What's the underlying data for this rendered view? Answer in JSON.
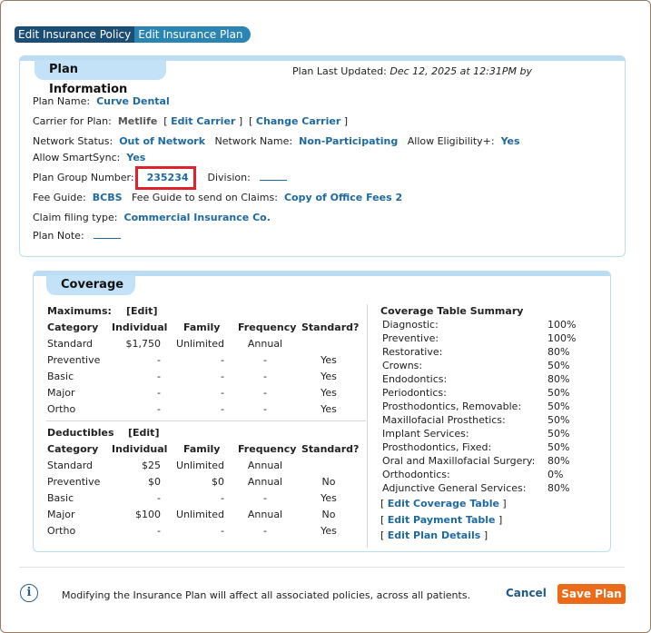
{
  "tabs": [
    "Edit Insurance Policy",
    "Edit Insurance Plan"
  ],
  "plan_info": {
    "header": "Plan Information",
    "last_updated_label": "Plan Last Updated:",
    "last_updated_value": "Dec 12, 2025 at 12:31PM by",
    "plan_name_label": "Plan Name:",
    "plan_name": "Curve Dental",
    "carrier_label": "Carrier for Plan:",
    "carrier": "Metlife",
    "edit_carrier": "Edit Carrier",
    "change_carrier": "Change Carrier",
    "network_status_label": "Network Status:",
    "network_status": "Out of Network",
    "network_name_label": "Network Name:",
    "network_name": "Non-Participating",
    "allow_eligibility_label": "Allow Eligibility+:",
    "allow_eligibility": "Yes",
    "allow_smartsync_label": "Allow SmartSync:",
    "allow_smartsync": "Yes",
    "group_number_label": "Plan Group Number:",
    "group_number": "235234",
    "division_label": "Division:",
    "fee_guide_label": "Fee Guide:",
    "fee_guide": "BCBS",
    "fee_guide_claims_label": "Fee Guide to send on Claims:",
    "fee_guide_claims": "Copy of Office Fees 2",
    "claim_type_label": "Claim filing type:",
    "claim_type": "Commercial Insurance Co.",
    "plan_note_label": "Plan Note:"
  },
  "coverage": {
    "header": "Coverage",
    "maximums_label": "Maximums:",
    "deductibles_label": "Deductibles",
    "edit_label": "[Edit]",
    "columns": [
      "Category",
      "Individual",
      "Family",
      "Frequency",
      "Standard?"
    ],
    "maximums": [
      [
        "Standard",
        "$1,750",
        "Unlimited",
        "Annual",
        ""
      ],
      [
        "Preventive",
        "-",
        "-",
        "-",
        "Yes"
      ],
      [
        "Basic",
        "-",
        "-",
        "-",
        "Yes"
      ],
      [
        "Major",
        "-",
        "-",
        "-",
        "Yes"
      ],
      [
        "Ortho",
        "-",
        "-",
        "-",
        "Yes"
      ]
    ],
    "deductibles": [
      [
        "Standard",
        "$25",
        "Unlimited",
        "Annual",
        ""
      ],
      [
        "Preventive",
        "$0",
        "$0",
        "Annual",
        "No"
      ],
      [
        "Basic",
        "-",
        "-",
        "-",
        "Yes"
      ],
      [
        "Major",
        "$100",
        "Unlimited",
        "Annual",
        "No"
      ],
      [
        "Ortho",
        "-",
        "-",
        "-",
        "Yes"
      ]
    ],
    "summary_title": "Coverage Table Summary",
    "summary": [
      [
        "Diagnostic:",
        "100%"
      ],
      [
        "Preventive:",
        "100%"
      ],
      [
        "Restorative:",
        "80%"
      ],
      [
        "Crowns:",
        "50%"
      ],
      [
        "Endodontics:",
        "80%"
      ],
      [
        "Periodontics:",
        "50%"
      ],
      [
        "Prosthodontics, Removable:",
        "50%"
      ],
      [
        "Maxillofacial Prosthetics:",
        "50%"
      ],
      [
        "Implant Services:",
        "50%"
      ],
      [
        "Prosthodontics, Fixed:",
        "50%"
      ],
      [
        "Oral and Maxillofacial Surgery:",
        "80%"
      ],
      [
        "Orthodontics:",
        "0%"
      ],
      [
        "Adjunctive General Services:",
        "80%"
      ]
    ],
    "edit_coverage_table": "Edit Coverage Table",
    "edit_payment_table": "Edit Payment Table",
    "edit_plan_details": "Edit Plan Details"
  },
  "footer": {
    "message": "Modifying the Insurance Plan will affect all associated policies, across all patients.",
    "cancel": "Cancel",
    "save": "Save Plan"
  }
}
